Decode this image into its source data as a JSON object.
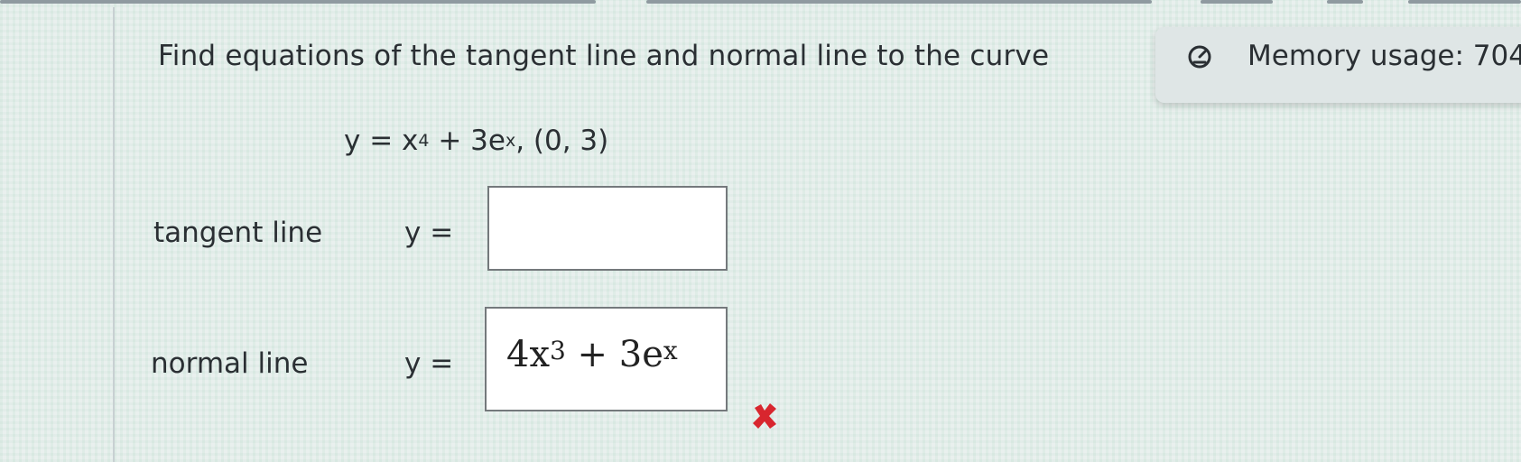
{
  "question": {
    "text": "Find equations of the tangent line and normal line to the curve"
  },
  "equation": {
    "lhs": "y = x",
    "exp1": "4",
    "mid": " + 3e",
    "exp2": "x",
    "point": ", (0, 3)"
  },
  "tangent": {
    "label": "tangent line",
    "eq_sign": "y =",
    "value": ""
  },
  "normal": {
    "label": "normal line",
    "eq_sign": "y =",
    "answer_base": "4x",
    "answer_exp1": "3",
    "answer_mid": " + 3e",
    "answer_exp2": "x",
    "status": "incorrect"
  },
  "memory": {
    "label": "Memory usage: 704"
  },
  "colors": {
    "wrong_mark": "#d8262e",
    "text": "#2a2f33"
  },
  "icons": {
    "wrong": "x-mark-icon",
    "memory": "gauge-icon"
  }
}
